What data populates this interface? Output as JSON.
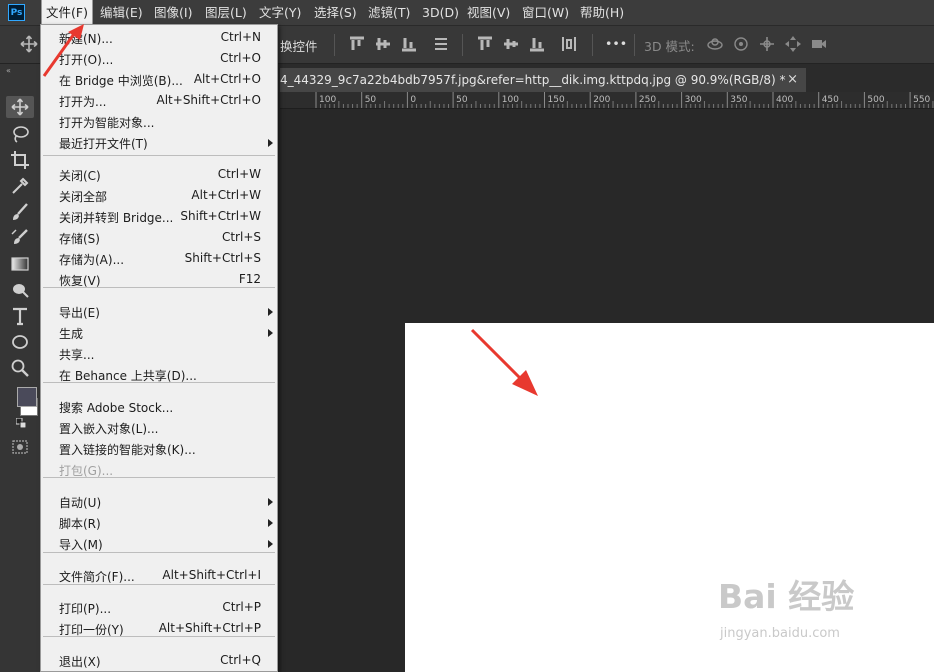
{
  "app": {
    "logo": "Ps"
  },
  "menubar": {
    "items": [
      "文件(F)",
      "编辑(E)",
      "图像(I)",
      "图层(L)",
      "文字(Y)",
      "选择(S)",
      "滤镜(T)",
      "3D(D)",
      "视图(V)",
      "窗口(W)",
      "帮助(H)"
    ],
    "active_index": 0
  },
  "options_bar": {
    "transform_label": "换控件",
    "mode3d_label": "3D 模式:",
    "more_label": "•••"
  },
  "document": {
    "tab_title": "4_44329_9c7a22b4bdb7957f.jpg&refer=http__dik.img.kttpdq.jpg @ 90.9%(RGB/8) *",
    "close_glyph": "×",
    "ruler_labels": [
      "100",
      "50",
      "0",
      "50",
      "100",
      "150",
      "200",
      "250",
      "300",
      "350",
      "400",
      "450",
      "500",
      "550"
    ]
  },
  "file_menu": {
    "items": [
      {
        "label": "新建(N)...",
        "shortcut": "Ctrl+N"
      },
      {
        "label": "打开(O)...",
        "shortcut": "Ctrl+O"
      },
      {
        "label": "在 Bridge 中浏览(B)...",
        "shortcut": "Alt+Ctrl+O"
      },
      {
        "label": "打开为...",
        "shortcut": "Alt+Shift+Ctrl+O"
      },
      {
        "label": "打开为智能对象...",
        "shortcut": ""
      },
      {
        "label": "最近打开文件(T)",
        "shortcut": "",
        "submenu": true
      },
      {
        "label": "关闭(C)",
        "shortcut": "Ctrl+W"
      },
      {
        "label": "关闭全部",
        "shortcut": "Alt+Ctrl+W"
      },
      {
        "label": "关闭并转到 Bridge...",
        "shortcut": "Shift+Ctrl+W"
      },
      {
        "label": "存储(S)",
        "shortcut": "Ctrl+S"
      },
      {
        "label": "存储为(A)...",
        "shortcut": "Shift+Ctrl+S"
      },
      {
        "label": "恢复(V)",
        "shortcut": "F12"
      },
      {
        "label": "导出(E)",
        "shortcut": "",
        "submenu": true
      },
      {
        "label": "生成",
        "shortcut": "",
        "submenu": true
      },
      {
        "label": "共享...",
        "shortcut": ""
      },
      {
        "label": "在 Behance 上共享(D)...",
        "shortcut": ""
      },
      {
        "label": "搜索 Adobe Stock...",
        "shortcut": ""
      },
      {
        "label": "置入嵌入对象(L)...",
        "shortcut": ""
      },
      {
        "label": "置入链接的智能对象(K)...",
        "shortcut": ""
      },
      {
        "label": "打包(G)...",
        "shortcut": "",
        "disabled": true
      },
      {
        "label": "自动(U)",
        "shortcut": "",
        "submenu": true
      },
      {
        "label": "脚本(R)",
        "shortcut": "",
        "submenu": true
      },
      {
        "label": "导入(M)",
        "shortcut": "",
        "submenu": true
      },
      {
        "label": "文件简介(F)...",
        "shortcut": "Alt+Shift+Ctrl+I"
      },
      {
        "label": "打印(P)...",
        "shortcut": "Ctrl+P"
      },
      {
        "label": "打印一份(Y)",
        "shortcut": "Alt+Shift+Ctrl+P"
      },
      {
        "label": "退出(X)",
        "shortcut": "Ctrl+Q"
      }
    ]
  },
  "colors": {
    "annotation_arrow": "#e8392f",
    "foreground_swatch": "#4a4a5a",
    "background_swatch": "#ffffff"
  },
  "watermark": {
    "text": "Bai 经验",
    "sub": "jingyan.baidu.com"
  }
}
